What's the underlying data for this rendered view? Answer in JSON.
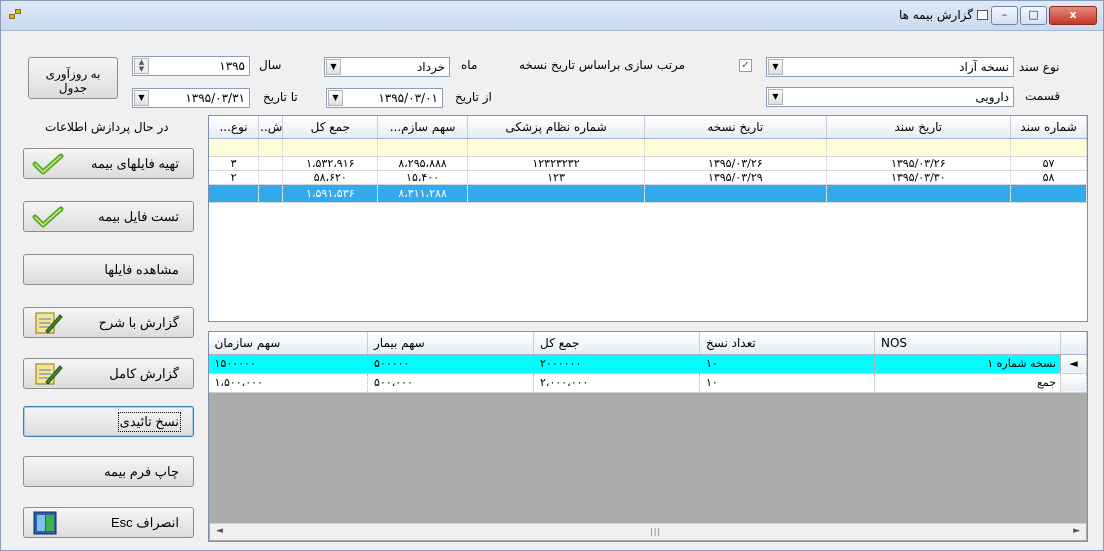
{
  "window": {
    "title": "گزارش بیمه ها",
    "close_label": "x",
    "max_label": "□",
    "min_label": "–"
  },
  "filters": {
    "doc_type_label": "نوع سند",
    "doc_type_value": "نسخه آزاد",
    "section_label": "قسمت",
    "section_value": "دارویی",
    "sort_checkbox_label": "مرتب سازی براساس تاریخ نسخه",
    "sort_checked": true,
    "month_label": "ماه",
    "month_value": "خرداد",
    "year_label": "سال",
    "year_value": "۱۳۹۵",
    "from_date_label": "از تاریخ",
    "from_date_value": "۱۳۹۵/۰۳/۰۱",
    "to_date_label": "تا تاریخ",
    "to_date_value": "۱۳۹۵/۰۳/۳۱",
    "refresh_label_line1": "به روزآوری",
    "refresh_label_line2": "جدول"
  },
  "status_text": "در حال پردازش اطلاعات",
  "buttons": {
    "prepare_files": "تهیه فایلهای بیمه",
    "test_file": "تست فایل بیمه",
    "view_files": "مشاهده فایلها",
    "report_desc": "گزارش با شرح",
    "report_full": "گزارش کامل",
    "approved_rx": "نسخ تائیدی",
    "print_form": "چاپ فرم بیمه",
    "cancel": "انصراف Esc"
  },
  "main_grid": {
    "columns": [
      "شماره سند",
      "تاریخ سند",
      "تاریخ نسخه",
      "شماره نظام پزشکی",
      "سهم سازم...",
      "جمع کل",
      "ش...",
      "نوع..."
    ],
    "rows": [
      [
        "۵۷",
        "۱۳۹۵/۰۳/۲۶",
        "۱۳۹۵/۰۳/۲۶",
        "۱۲۳۲۳۲۳۲",
        "۸،۲۹۵،۸۸۸",
        "۱،۵۳۲،۹۱۶",
        "",
        "۳"
      ],
      [
        "۵۸",
        "۱۳۹۵/۰۳/۳۰",
        "۱۳۹۵/۰۳/۲۹",
        "۱۲۳",
        "۱۵،۴۰۰",
        "۵۸،۶۲۰",
        "",
        "۲"
      ]
    ],
    "total_row": [
      "",
      "",
      "",
      "",
      "۸،۳۱۱،۲۸۸",
      "۱،۵۹۱،۵۳۶",
      "",
      ""
    ]
  },
  "summary_grid": {
    "columns": [
      "NOS",
      "تعداد نسخ",
      "جمع کل",
      "سهم بیمار",
      "سهم سازمان"
    ],
    "rows": [
      [
        "نسخه شماره ۱",
        "۱۰",
        "۲۰۰۰۰۰۰",
        "۵۰۰۰۰۰",
        "۱۵۰۰۰۰۰"
      ],
      [
        "جمع",
        "۱۰",
        "۲،۰۰۰،۰۰۰",
        "۵۰۰،۰۰۰",
        "۱،۵۰۰،۰۰۰"
      ]
    ],
    "current_row_marker": "◄"
  },
  "colors": {
    "selected_row": "#33aaee",
    "new_row": "#fffdd8",
    "summary_highlight": "#00ffff"
  }
}
